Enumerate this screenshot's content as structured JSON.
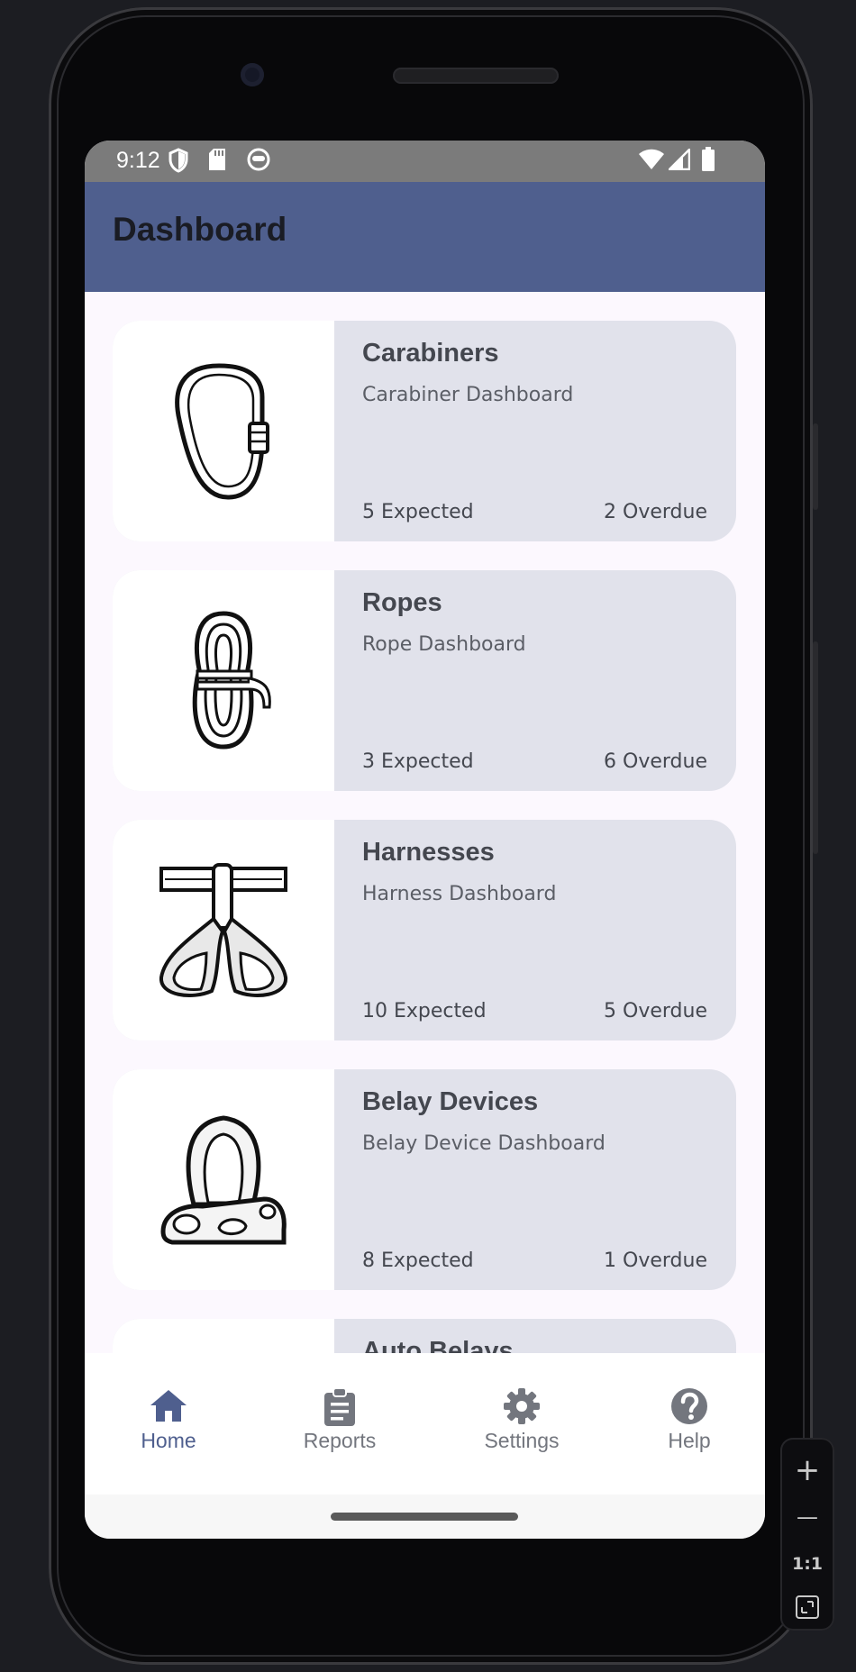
{
  "status_bar": {
    "time": "9:12",
    "left_icons": [
      "shield-icon",
      "sd-card-icon",
      "face-icon"
    ],
    "right_icons": [
      "wifi-icon",
      "signal-icon",
      "battery-icon"
    ]
  },
  "app_bar": {
    "title": "Dashboard",
    "color": "#4f5f8e"
  },
  "cards": [
    {
      "title": "Carabiners",
      "subtitle": "Carabiner Dashboard",
      "expected": "5 Expected",
      "overdue": "2 Overdue",
      "icon": "carabiner-icon"
    },
    {
      "title": "Ropes",
      "subtitle": "Rope Dashboard",
      "expected": "3 Expected",
      "overdue": "6 Overdue",
      "icon": "rope-icon"
    },
    {
      "title": "Harnesses",
      "subtitle": "Harness Dashboard",
      "expected": "10 Expected",
      "overdue": "5 Overdue",
      "icon": "harness-icon"
    },
    {
      "title": "Belay Devices",
      "subtitle": "Belay Device Dashboard",
      "expected": "8 Expected",
      "overdue": "1 Overdue",
      "icon": "belay-device-icon"
    },
    {
      "title": "Auto Belays",
      "subtitle": "",
      "expected": "",
      "overdue": "",
      "icon": "auto-belay-icon"
    }
  ],
  "bottom_nav": {
    "items": [
      {
        "label": "Home",
        "icon": "home-icon",
        "active": true
      },
      {
        "label": "Reports",
        "icon": "clipboard-icon",
        "active": false
      },
      {
        "label": "Settings",
        "icon": "gear-icon",
        "active": false
      },
      {
        "label": "Help",
        "icon": "help-icon",
        "active": false
      }
    ],
    "active_color": "#4f5f8e"
  },
  "emulator_toolbar": {
    "buttons": [
      {
        "label": "+",
        "icon": "zoom-in-icon"
      },
      {
        "label": "—",
        "icon": "zoom-out-icon"
      },
      {
        "label": "1:1",
        "icon": "actual-size-icon"
      },
      {
        "label": "",
        "icon": "fit-screen-icon"
      }
    ]
  }
}
